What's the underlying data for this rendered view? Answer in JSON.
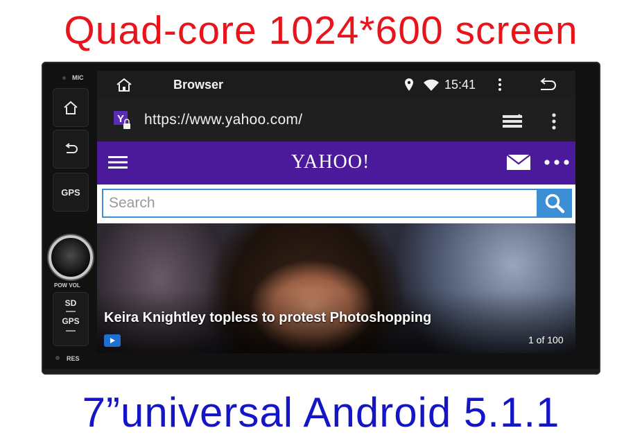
{
  "banner": {
    "top": "Quad-core 1024*600 screen",
    "bottom": "7”universal Android 5.1.1"
  },
  "device_panel": {
    "mic": "MIC",
    "gps": "GPS",
    "pow_vol": "POW  VOL",
    "sd": "SD",
    "gps2": "GPS",
    "res": "RES"
  },
  "statusbar": {
    "app_title": "Browser",
    "time": "15:41"
  },
  "urlbar": {
    "url": "https://www.yahoo.com/"
  },
  "yahoo": {
    "logo": "YAHOO!",
    "search_placeholder": "Search"
  },
  "hero": {
    "headline": "Keira Knightley topless to protest Photoshopping",
    "counter": "1 of 100"
  },
  "colors": {
    "headline_red": "#e8141b",
    "footline_blue": "#1515c8",
    "yahoo_purple": "#4a1a9a",
    "search_blue": "#3c8fd4"
  }
}
